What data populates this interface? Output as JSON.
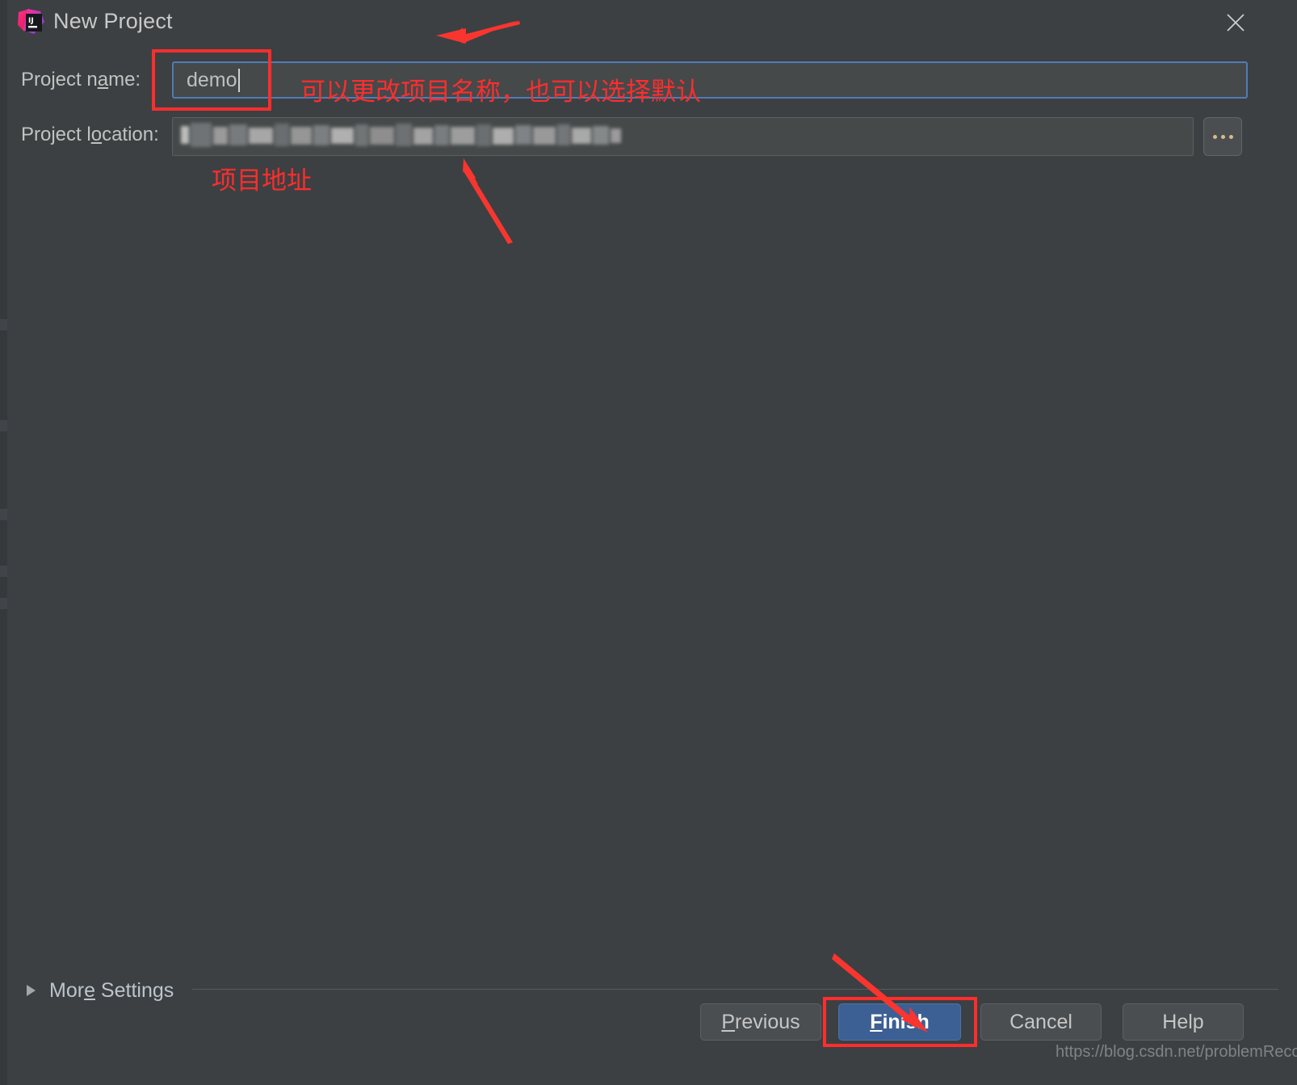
{
  "window": {
    "title": "New Project",
    "app_icon": "intellij-idea-logo",
    "close_icon": "close-icon"
  },
  "form": {
    "project_name": {
      "label_before": "Project n",
      "label_mnemonic": "a",
      "label_after": "me:",
      "label_full": "Project name:",
      "value": "demo",
      "focused": true
    },
    "project_location": {
      "label_before": "Project l",
      "label_mnemonic": "o",
      "label_after": "cation:",
      "label_full": "Project location:",
      "value": "",
      "redacted": true,
      "browse_button": {
        "label": "...",
        "icon": "ellipsis-icon"
      }
    }
  },
  "more_settings": {
    "label_before": "Mor",
    "label_mnemonic": "e",
    "label_after": " Settings",
    "label_full": "More Settings",
    "expanded": false,
    "chevron_icon": "triangle-right-icon"
  },
  "buttons": {
    "previous": {
      "label_before": "P",
      "label_mnemonic": "",
      "label_after": "revious",
      "label_full": "Previous",
      "mnemonic_char": "P"
    },
    "finish": {
      "label_before": "",
      "label_mnemonic": "F",
      "label_after": "inish",
      "label_full": "Finish",
      "primary": true
    },
    "cancel": {
      "label_full": "Cancel"
    },
    "help": {
      "label_full": "Help"
    }
  },
  "annotations": {
    "name_note": "可以更改项目名称，也可以选择默认",
    "location_note": "项目地址",
    "arrow_to_title": "arrow-left",
    "arrow_to_location": "arrow-up-left",
    "arrow_to_finish": "arrow-down-right",
    "highlight_color": "#ff2d2d"
  },
  "watermark": {
    "text": "https://blog.csdn.net/problemRecord"
  },
  "colors": {
    "background": "#3c4042",
    "field_background": "#45494a",
    "focus_border": "#4f7cb4",
    "primary_button": "#3c6093",
    "text": "#c2c2c2",
    "annotation_red": "#ff2d2d"
  }
}
